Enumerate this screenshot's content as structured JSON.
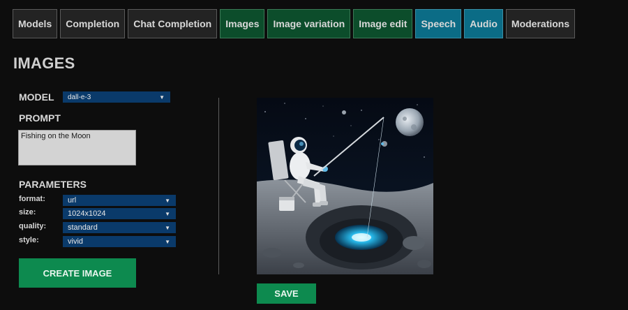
{
  "tabs": [
    {
      "label": "Models",
      "style": "default"
    },
    {
      "label": "Completion",
      "style": "default"
    },
    {
      "label": "Chat Completion",
      "style": "default"
    },
    {
      "label": "Images",
      "style": "green"
    },
    {
      "label": "Image variation",
      "style": "green"
    },
    {
      "label": "Image edit",
      "style": "green"
    },
    {
      "label": "Speech",
      "style": "blue"
    },
    {
      "label": "Audio",
      "style": "blue"
    },
    {
      "label": "Moderations",
      "style": "default"
    }
  ],
  "page": {
    "title": "IMAGES"
  },
  "model": {
    "label": "MODEL",
    "value": "dall-e-3"
  },
  "prompt": {
    "label": "PROMPT",
    "value": "Fishing on the Moon"
  },
  "parameters": {
    "label": "PARAMETERS",
    "format": {
      "label": "format:",
      "value": "url"
    },
    "size": {
      "label": "size:",
      "value": "1024x1024"
    },
    "quality": {
      "label": "quality:",
      "value": "standard"
    },
    "style": {
      "label": "style:",
      "value": "vivid"
    }
  },
  "actions": {
    "create_label": "CREATE IMAGE",
    "save_label": "SAVE"
  },
  "icons": {
    "dropdown": "caret-down-icon"
  },
  "colors": {
    "background": "#0d0d0d",
    "tab_default": "#232323",
    "tab_green": "#0c4d2b",
    "tab_blue": "#0b6c86",
    "select_bg": "#0a3a6a",
    "button_green": "#0d8a4f"
  }
}
